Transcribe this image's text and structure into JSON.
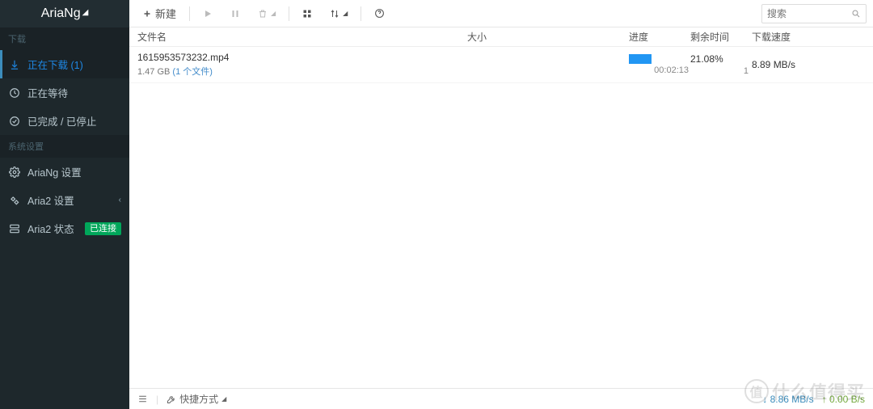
{
  "brand": "AriaNg",
  "sidebar": {
    "section_download": "下载",
    "section_system": "系统设置",
    "items": {
      "downloading": "正在下载 (1)",
      "waiting": "正在等待",
      "stopped": "已完成 / 已停止",
      "ariang_settings": "AriaNg 设置",
      "aria2_settings": "Aria2 设置",
      "aria2_status": "Aria2 状态"
    },
    "status_badge": "已连接"
  },
  "toolbar": {
    "new_label": "新建",
    "search_placeholder": "搜索"
  },
  "columns": {
    "name": "文件名",
    "size": "大小",
    "progress": "进度",
    "remaining": "剩余时间",
    "speed": "下载速度"
  },
  "tasks": [
    {
      "name": "1615953573232.mp4",
      "size": "1.47 GB",
      "file_count_label": "(1 个文件)",
      "percent": "21.08%",
      "elapsed": "00:02:13",
      "connections": "1",
      "speed": "8.89 MB/s"
    }
  ],
  "footer": {
    "quick": "快捷方式",
    "down_speed": "8.86 MB/s",
    "up_speed": "0.00 B/s"
  },
  "watermark": "什么值得买"
}
